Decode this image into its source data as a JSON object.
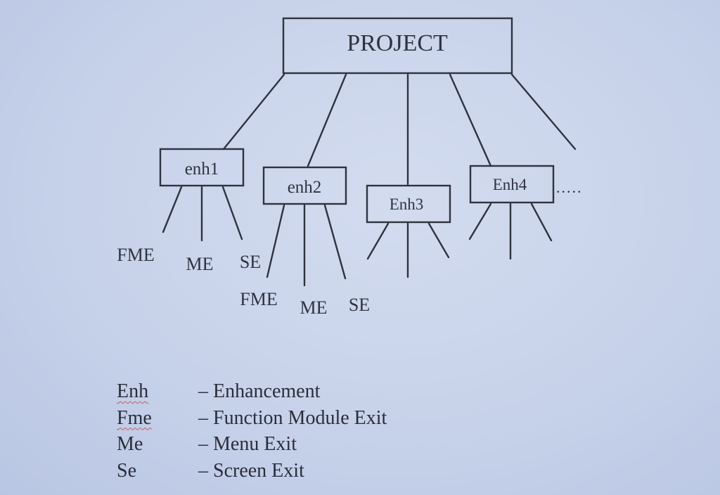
{
  "diagram": {
    "root": "PROJECT",
    "children": [
      {
        "label": "enh1",
        "leaves": [
          "FME",
          "ME",
          "SE"
        ]
      },
      {
        "label": "enh2",
        "leaves": [
          "FME",
          "ME",
          "SE"
        ]
      },
      {
        "label": "Enh3",
        "leaves": []
      },
      {
        "label": "Enh4",
        "leaves": []
      }
    ],
    "ellipsis": "....."
  },
  "legend": [
    {
      "abbr": "Enh",
      "definition": "– Enhancement",
      "spellcheck_underline": true
    },
    {
      "abbr": "Fme",
      "definition": "– Function Module Exit",
      "spellcheck_underline": true
    },
    {
      "abbr": "Me",
      "definition": "– Menu Exit",
      "spellcheck_underline": false
    },
    {
      "abbr": "Se",
      "definition": "– Screen Exit",
      "spellcheck_underline": false
    }
  ],
  "colors": {
    "background": "#c7d2ea",
    "ink": "#2f3340",
    "spellcheck": "#c85a5a"
  }
}
